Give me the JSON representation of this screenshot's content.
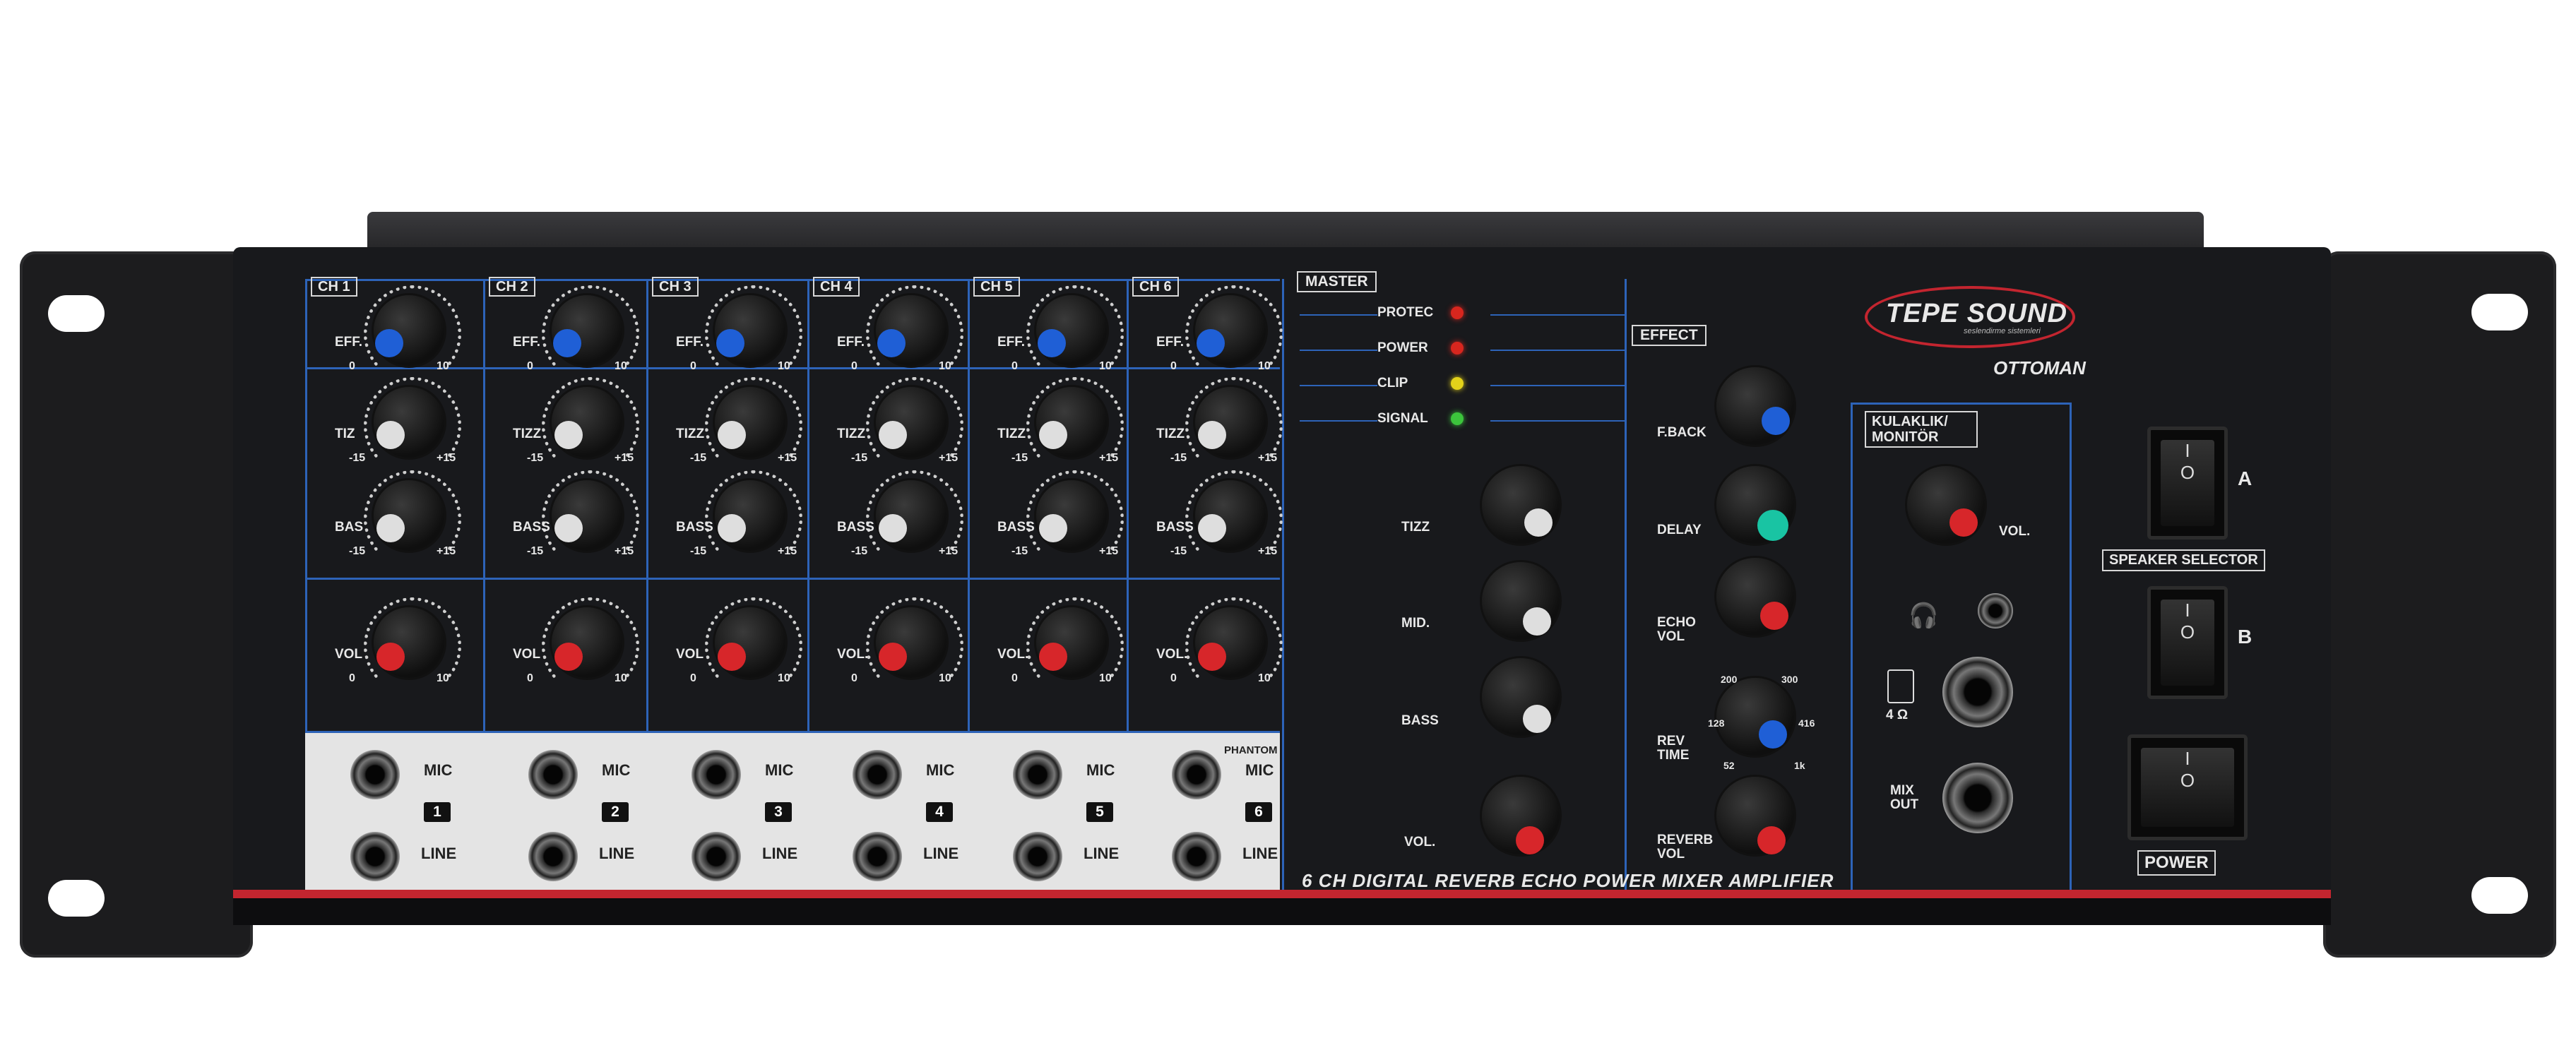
{
  "brand": {
    "name": "TEPE SOUND",
    "tagline": "seslendirme sistemleri",
    "model": "OTTOMAN"
  },
  "footer_text": "6 CH DIGITAL REVERB ECHO POWER MIXER AMPLIFIER",
  "channels": [
    {
      "label": "CH 1",
      "eff": "EFF.",
      "tizz": "TIZ",
      "bass": "BAS",
      "vol": "VOL",
      "num": "1"
    },
    {
      "label": "CH 2",
      "eff": "EFF.",
      "tizz": "TIZZ",
      "bass": "BASS",
      "vol": "VOL",
      "num": "2"
    },
    {
      "label": "CH 3",
      "eff": "EFF.",
      "tizz": "TIZZ",
      "bass": "BASS",
      "vol": "VOL",
      "num": "3"
    },
    {
      "label": "CH 4",
      "eff": "EFF.",
      "tizz": "TIZZ",
      "bass": "BASS",
      "vol": "VOL.",
      "num": "4"
    },
    {
      "label": "CH 5",
      "eff": "EFF.",
      "tizz": "TIZZ",
      "bass": "BASS",
      "vol": "VOL.",
      "num": "5"
    },
    {
      "label": "CH 6",
      "eff": "EFF.",
      "tizz": "TIZZ",
      "bass": "BASS",
      "vol": "VOL.",
      "num": "6"
    }
  ],
  "scale_labels": {
    "zero": "0",
    "ten": "10",
    "minus15": "-15",
    "plus15": "+15"
  },
  "jacks": {
    "mic": "MIC",
    "line": "LINE",
    "phantom": "PHANTOM"
  },
  "master": {
    "label": "MASTER",
    "leds": [
      {
        "label": "PROTEC",
        "color": "#d7261e"
      },
      {
        "label": "POWER",
        "color": "#d7261e"
      },
      {
        "label": "CLIP",
        "color": "#e3d21a"
      },
      {
        "label": "SIGNAL",
        "color": "#3cc43c"
      }
    ],
    "tizz": "TIZZ",
    "mid": "MID.",
    "bass": "BASS",
    "vol": "VOL."
  },
  "effect": {
    "label": "EFFECT",
    "fback": "F.BACK",
    "delay": "DELAY",
    "echo_vol": "ECHO VOL",
    "rev_time": "REV TIME",
    "reverb_vol": "REVERB VOL",
    "rev_scale": [
      "200",
      "300",
      "128",
      "416",
      "52",
      "1k"
    ]
  },
  "monitor": {
    "label": "KULAKLIK/ MONITÖR",
    "vol": "VOL.",
    "ohm": "4 Ω",
    "mix_out": "MIX OUT"
  },
  "speaker": {
    "a": "A",
    "b": "B",
    "selector": "SPEAKER SELECTOR",
    "power": "POWER",
    "on": "I",
    "off": "O"
  },
  "colors": {
    "blue": "#1f5fd6",
    "white": "#dedede",
    "red": "#d7262a",
    "teal": "#19c4a3",
    "stripe": "#c3252f",
    "line": "#2d63b8"
  }
}
